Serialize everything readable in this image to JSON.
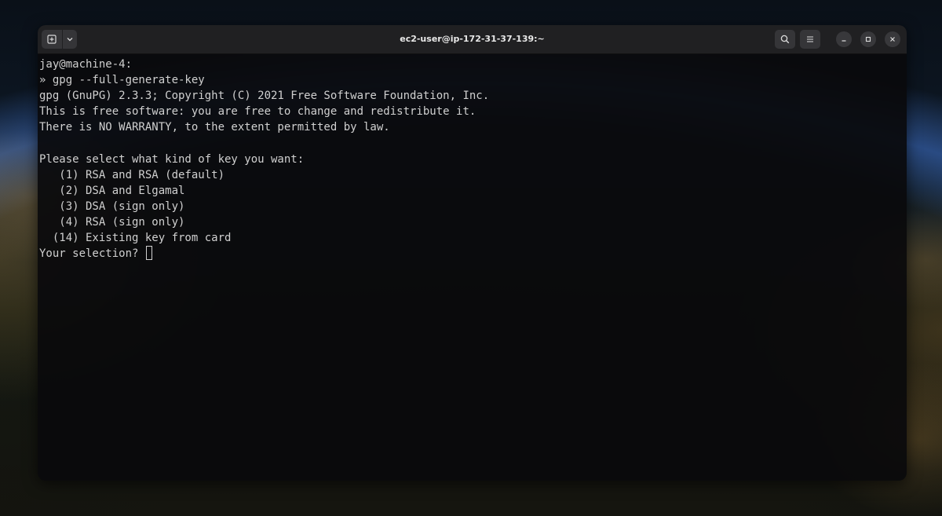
{
  "window": {
    "title": "ec2-user@ip-172-31-37-139:~"
  },
  "icons": {
    "new_tab": "new-tab-icon",
    "dropdown": "chevron-down-icon",
    "search": "search-icon",
    "menu": "hamburger-menu-icon",
    "minimize": "minimize-icon",
    "maximize": "maximize-icon",
    "close": "close-icon"
  },
  "terminal": {
    "lines": [
      "jay@machine-4:",
      "» gpg --full-generate-key",
      "gpg (GnuPG) 2.3.3; Copyright (C) 2021 Free Software Foundation, Inc.",
      "This is free software: you are free to change and redistribute it.",
      "There is NO WARRANTY, to the extent permitted by law.",
      "",
      "Please select what kind of key you want:",
      "   (1) RSA and RSA (default)",
      "   (2) DSA and Elgamal",
      "   (3) DSA (sign only)",
      "   (4) RSA (sign only)",
      "  (14) Existing key from card",
      "Your selection? "
    ]
  },
  "colors": {
    "terminal_background": "#0a0a0c",
    "terminal_foreground": "#d0d0d0",
    "titlebar": "#202022"
  }
}
